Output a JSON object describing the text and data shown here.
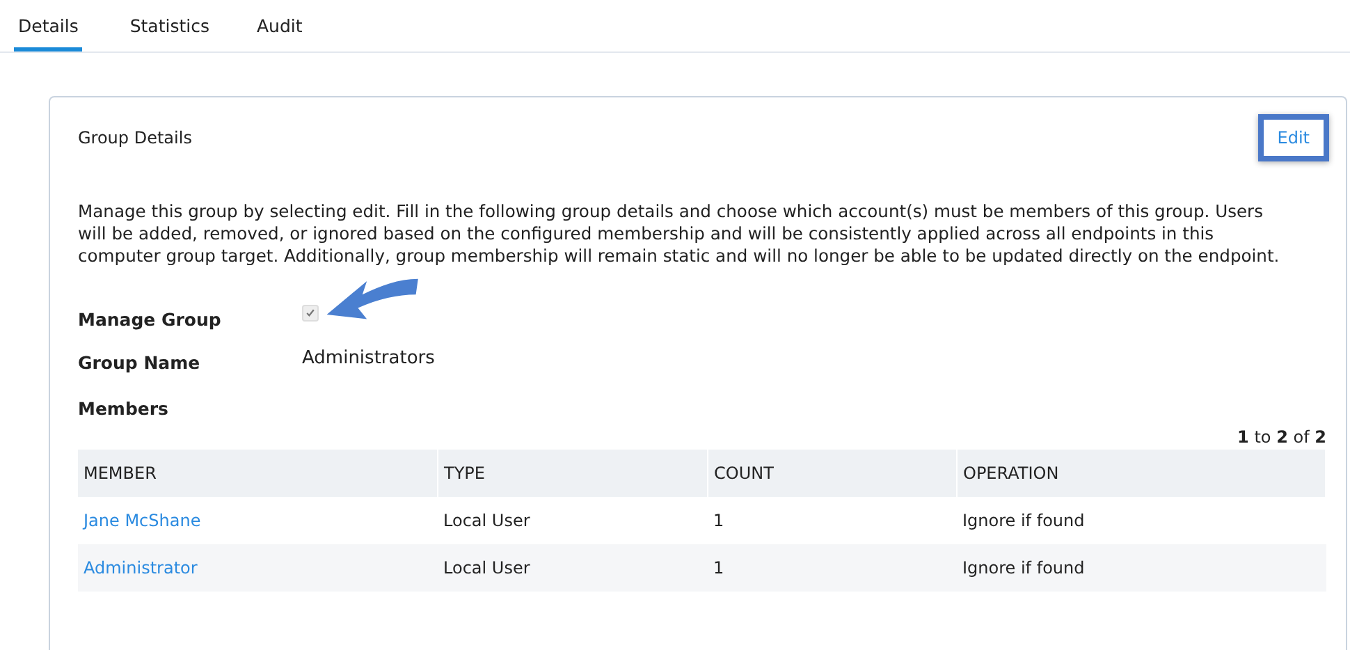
{
  "tabs": [
    {
      "label": "Details",
      "selected": true
    },
    {
      "label": "Statistics",
      "selected": false
    },
    {
      "label": "Audit",
      "selected": false
    }
  ],
  "card": {
    "title": "Group Details",
    "edit_button": {
      "label": "Edit",
      "highlighted": true
    },
    "description": "Manage this group by selecting edit. Fill in the following group details and choose which account(s) must be members of this group. Users will be added, removed, or ignored based on the configured membership and will be consistently applied across all endpoints in this computer group target. Additionally, group membership will remain static and will no longer be able to be updated directly on the endpoint.",
    "manage_group": {
      "label": "Manage Group",
      "checked": true,
      "disabled": true
    },
    "group_name": {
      "label": "Group Name",
      "value": "Administrators"
    },
    "members": {
      "title": "Members",
      "pagination": "**1** to **2** of **2**",
      "columns": [
        "MEMBER",
        "TYPE",
        "COUNT",
        "OPERATION"
      ],
      "rows": [
        {
          "member": "Jane McShane",
          "type": "Local User",
          "count": "1",
          "operation": "Ignore if found"
        },
        {
          "member": "Administrator",
          "type": "Local User",
          "count": "1",
          "operation": "Ignore if found"
        }
      ]
    }
  }
}
